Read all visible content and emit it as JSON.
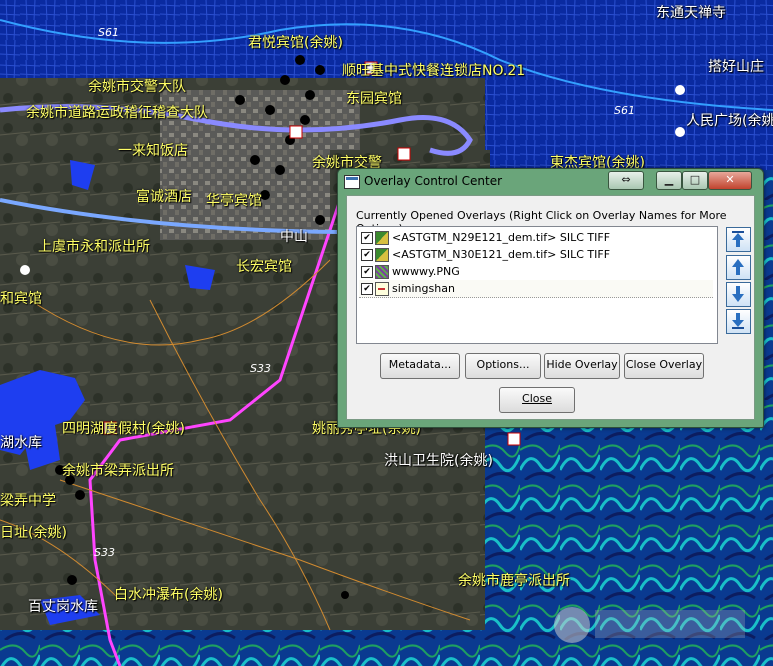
{
  "map": {
    "labels": {
      "l1": "东通天禅寺",
      "l2": "君悦宾馆(余姚)",
      "l3": "顺旺基中式快餐连锁店NO.21",
      "l4": "余姚市交警大队",
      "l5": "搭好山庄",
      "l6": "余姚市道路运政稽征稽查大队",
      "l7": "东园宾馆",
      "l8": "人民广场(余姚)",
      "l9": "一来知饭店",
      "l10": "余姚市交警",
      "l11": "東杰宾馆(余姚)",
      "l12": "富诚酒店",
      "l13": "华亭宾馆",
      "l14": "上虞市永和派出所",
      "l15": "长宏宾馆",
      "l16": "和宾馆",
      "l17": "四明湖度假村(余姚)",
      "l18": "姚丽秀亭址(余姚)",
      "l19": "湖水库",
      "l20": "洪山卫生院(余姚)",
      "l21": "余姚市梁弄派出所",
      "l22": "梁弄中学",
      "l23": "日址(余姚)",
      "l24": "白水冲瀑布(余姚)",
      "l25": "百丈岗水库",
      "l26": "余姚市鹿亭派出所",
      "l27": "中山"
    },
    "roads": {
      "r1": "S61",
      "r2": "S61",
      "r3": "S33",
      "r4": "S33"
    }
  },
  "dialog": {
    "title": "Overlay Control Center",
    "header": "Currently Opened Overlays (Right Click on Overlay Names for More Options)",
    "overlays": [
      {
        "checked": "✔",
        "name": "<ASTGTM_N29E121_dem.tif> SILC TIFF",
        "icon": "raster-tif-icon"
      },
      {
        "checked": "✔",
        "name": "<ASTGTM_N30E121_dem.tif> SILC TIFF",
        "icon": "raster-tif-icon"
      },
      {
        "checked": "✔",
        "name": "wwwwy.PNG",
        "icon": "raster-png-icon"
      },
      {
        "checked": "✔",
        "name": "simingshan",
        "icon": "vector-icon"
      }
    ],
    "buttons": {
      "metadata": "Metadata...",
      "options": "Options...",
      "hide": "Hide Overlay",
      "close_overlay": "Close Overlay",
      "close": "Close"
    }
  }
}
